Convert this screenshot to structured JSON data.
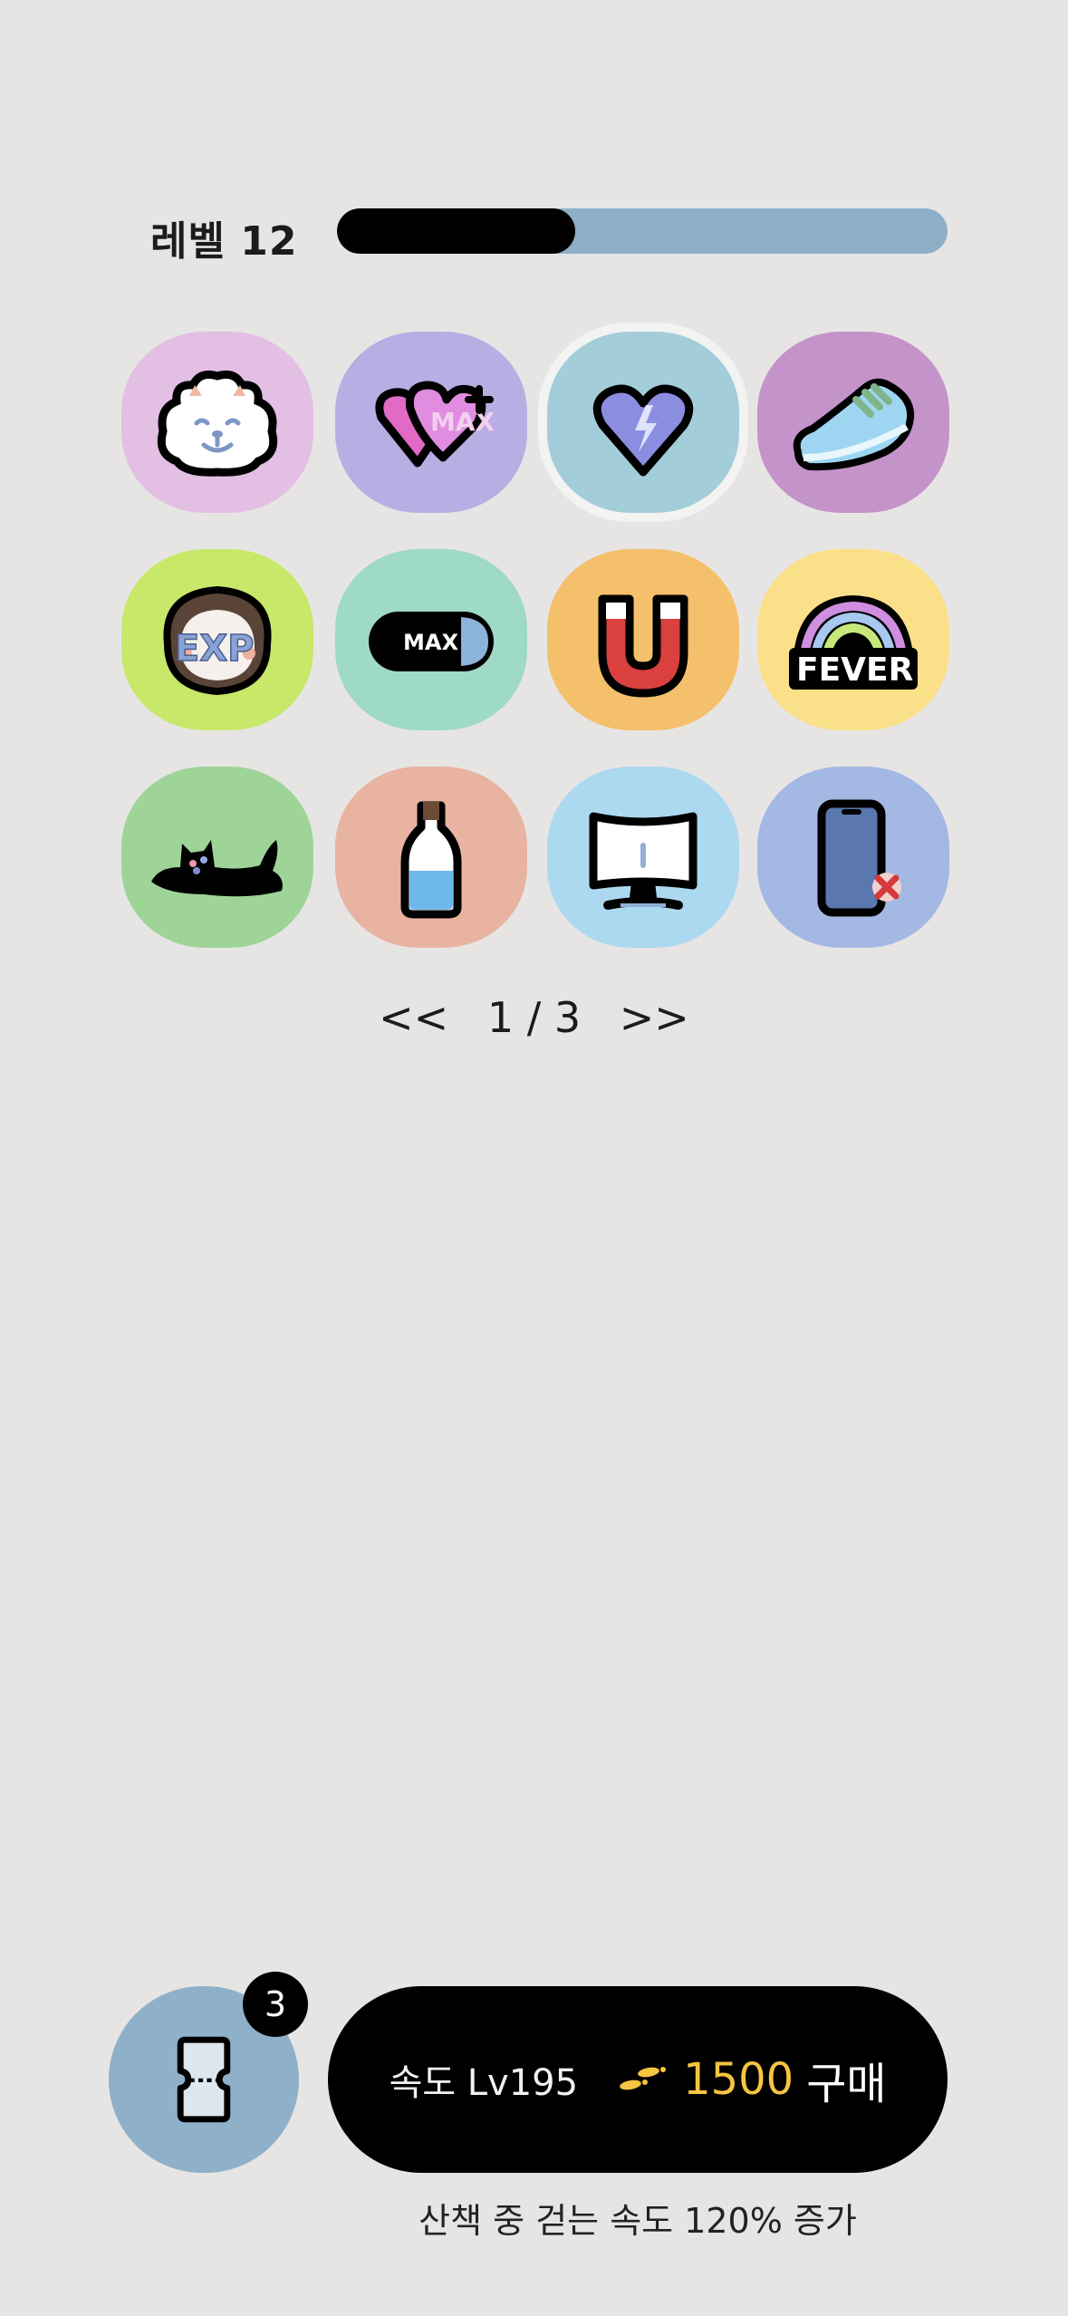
{
  "level": {
    "label": "레벨 12",
    "progress": 0.39
  },
  "items": [
    {
      "name": "samoyed",
      "bg": "#e2bfe3"
    },
    {
      "name": "max-hearts",
      "bg": "#b8aee3"
    },
    {
      "name": "lightning-heart",
      "bg": "#a3cdd9",
      "selected": true
    },
    {
      "name": "sneaker",
      "bg": "#c493c9"
    },
    {
      "name": "exp-face",
      "bg": "#c8e86a"
    },
    {
      "name": "max-battery",
      "bg": "#9fd9c8"
    },
    {
      "name": "magnet",
      "bg": "#f4c06b"
    },
    {
      "name": "fever-rainbow",
      "bg": "#fbe08a"
    },
    {
      "name": "black-cat",
      "bg": "#9ed498"
    },
    {
      "name": "water-bottle",
      "bg": "#e8b3a0"
    },
    {
      "name": "monitor",
      "bg": "#acd9ef"
    },
    {
      "name": "phone-off",
      "bg": "#a3b8e3"
    }
  ],
  "pager": {
    "prev": "<<",
    "text": "1 / 3",
    "next": ">>"
  },
  "ticket": {
    "badge": "3"
  },
  "buy": {
    "stat": "속도 Lv195",
    "price": "1500",
    "label": "구매"
  },
  "description": "산책 중 걷는 속도 120% 증가"
}
